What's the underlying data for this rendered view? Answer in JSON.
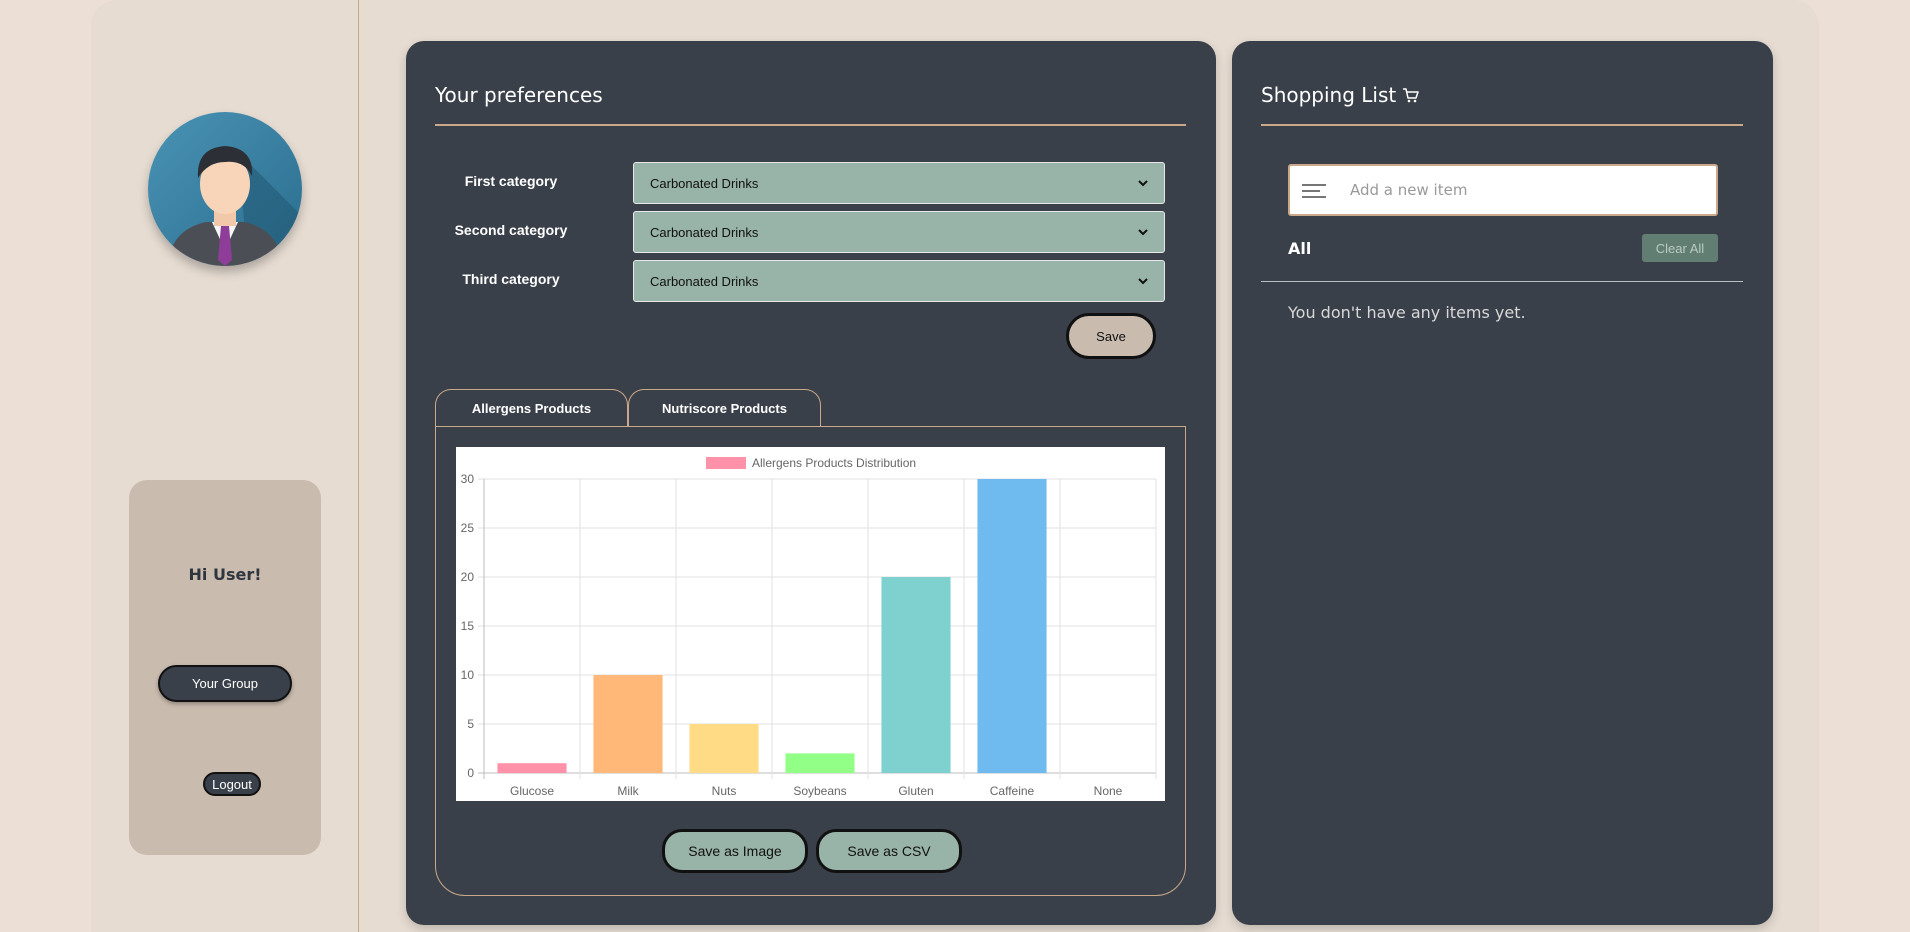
{
  "user": {
    "greeting": "Hi User!"
  },
  "nav": {
    "group_label": "Your Group",
    "logout_label": "Logout"
  },
  "preferences": {
    "title": "Your preferences",
    "rows": [
      {
        "label": "First category",
        "value": "Carbonated Drinks"
      },
      {
        "label": "Second category",
        "value": "Carbonated Drinks"
      },
      {
        "label": "Third category",
        "value": "Carbonated Drinks"
      }
    ],
    "save_label": "Save"
  },
  "tabs": [
    {
      "label": "Allergens Products",
      "active": true
    },
    {
      "label": "Nutriscore Products",
      "active": false
    }
  ],
  "chart_data": {
    "type": "bar",
    "categories": [
      "Glucose",
      "Milk",
      "Nuts",
      "Soybeans",
      "Gluten",
      "Caffeine",
      "None"
    ],
    "series": [
      {
        "name": "Allergens Products Distribution",
        "values": [
          1,
          10,
          5,
          2,
          20,
          30,
          0
        ]
      }
    ],
    "colors": [
      "#ff92a8",
      "#ffb877",
      "#ffdb86",
      "#92ff86",
      "#7fd1cf",
      "#6fbbef",
      "#c9cbcf"
    ],
    "legend_color": "#ff92a8",
    "ylim": [
      0,
      30
    ],
    "yticks": [
      0,
      5,
      10,
      15,
      20,
      25,
      30
    ],
    "grid": true,
    "legend": "top-center"
  },
  "export": {
    "image_label": "Save as Image",
    "csv_label": "Save as CSV"
  },
  "shopping": {
    "title": "Shopping List",
    "input_placeholder": "Add a new item",
    "filter_label": "All",
    "clear_label": "Clear All",
    "empty_message": "You don't have any items yet."
  },
  "icons": {
    "cart": "shopping-cart-icon",
    "menu": "menu-lines-icon",
    "chevron": "chevron-down-icon",
    "avatar": "user-avatar-icon"
  },
  "colors": {
    "background": "#ece0d6",
    "panel": "#3a4049",
    "accent": "#c9a98a",
    "select_bg": "#98b3a7",
    "card": "#c9bbae"
  }
}
